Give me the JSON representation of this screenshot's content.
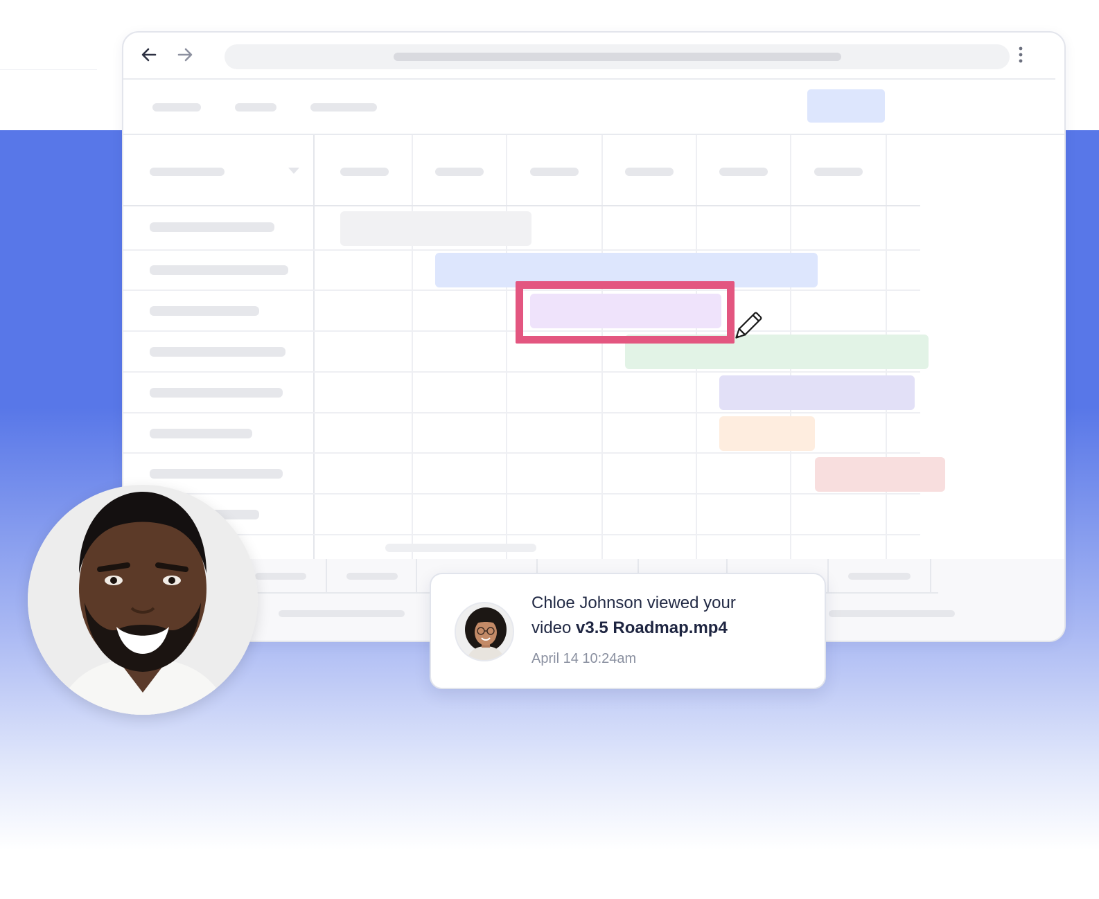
{
  "notification": {
    "line1": "Chloe Johnson viewed your",
    "line2_prefix": "video",
    "filename": "v3.5 Roadmap.mp4",
    "timestamp": "April 14 10:24am"
  },
  "icons": {
    "back": "arrow-left-icon",
    "forward": "arrow-right-icon",
    "menu": "vertical-dots-icon",
    "cursor": "pencil-icon",
    "dropdown": "caret-down-icon"
  },
  "colors": {
    "hero_blue": "#5877e8",
    "highlight": "#e35680",
    "bar_gray": "#f1f1f3",
    "bar_blue": "#dde6fd",
    "bar_lilac": "#efe3fb",
    "bar_green": "#e2f3e6",
    "bar_purple": "#e2e0f7",
    "bar_peach": "#feeddf",
    "bar_pink": "#f8dede"
  }
}
